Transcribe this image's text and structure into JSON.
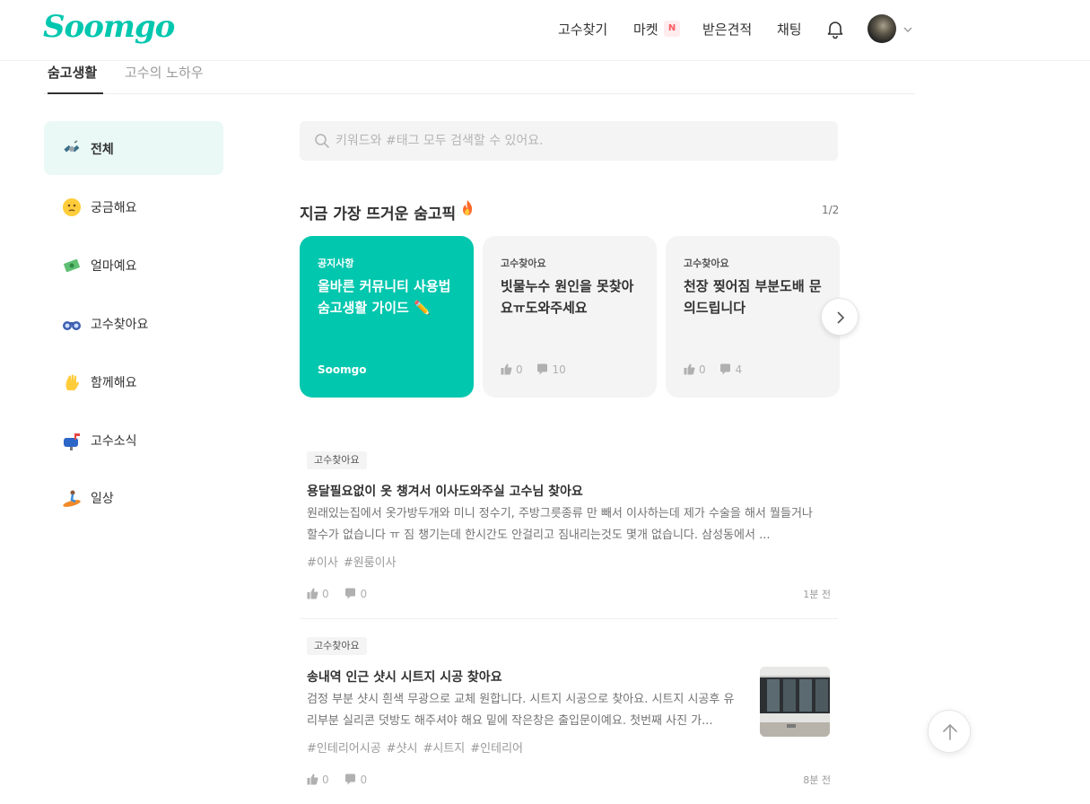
{
  "header": {
    "logo": "Soomgo",
    "nav": {
      "find": "고수찾기",
      "market": "마켓",
      "market_badge": "N",
      "quotes": "받은견적",
      "chat": "채팅"
    },
    "icons": [
      "bell-icon",
      "avatar",
      "chevron-down-icon"
    ]
  },
  "tabs": [
    {
      "label": "숨고생활",
      "active": true
    },
    {
      "label": "고수의 노하우",
      "active": false
    }
  ],
  "sidebar": {
    "items": [
      {
        "label": "전체",
        "icon": "satellite-icon",
        "active": true
      },
      {
        "label": "궁금해요",
        "icon": "thinking-face-icon"
      },
      {
        "label": "얼마예요",
        "icon": "money-icon"
      },
      {
        "label": "고수찾아요",
        "icon": "binoculars-icon"
      },
      {
        "label": "함께해요",
        "icon": "waving-hand-icon"
      },
      {
        "label": "고수소식",
        "icon": "mailbox-icon"
      },
      {
        "label": "일상",
        "icon": "surfer-icon"
      }
    ]
  },
  "search": {
    "placeholder": "키워드와 #태그 모두 검색할 수 있어요."
  },
  "hot": {
    "title": "지금 가장 뜨거운 숨고픽",
    "page": "1/2",
    "cards": [
      {
        "category": "공지사항",
        "title": "올바른 커뮤니티 사용법 숨고생활 가이드 ✏️",
        "brand": "Soomgo"
      },
      {
        "category": "고수찾아요",
        "title": "빗물누수 원인을 못찾아요ㅠ도와주세요",
        "likes": "0",
        "comments": "10"
      },
      {
        "category": "고수찾아요",
        "title": "천장 찢어짐 부분도배 문의드립니다",
        "likes": "0",
        "comments": "4"
      }
    ]
  },
  "posts": [
    {
      "category": "고수찾아요",
      "title": "용달필요없이 옷 챙겨서 이사도와주실 고수님 찾아요",
      "body": "원래있는집에서 옷가방두개와 미니 정수기, 주방그릇종류 만 빼서 이사하는데 제가 수술을 해서 뭘들거나 할수가 없습니다 ㅠ 짐 챙기는데 한시간도 안걸리고 짐내리는것도 몇개 없습니다. 삼성동에서 ...",
      "tags": [
        "#이사",
        "#원룸이사"
      ],
      "likes": "0",
      "comments": "0",
      "time": "1분 전"
    },
    {
      "category": "고수찾아요",
      "title": "송내역 인근 샷시 시트지 시공 찾아요",
      "body": "검정 부분 샷시 흰색 무광으로 교체 원합니다. 시트지 시공으로 찾아요. 시트지 시공후 유리부분 실리콘 덧방도 해주셔야 해요 밑에 작은창은 출입문이예요. 첫번째 사진 가...",
      "tags": [
        "#인테리어시공",
        "#샷시",
        "#시트지",
        "#인테리어"
      ],
      "likes": "0",
      "comments": "0",
      "time": "8분 전"
    }
  ],
  "colors": {
    "brand": "#00c7ae",
    "active_bg": "#eaf9f6",
    "new_badge": "#ff5a5f"
  }
}
